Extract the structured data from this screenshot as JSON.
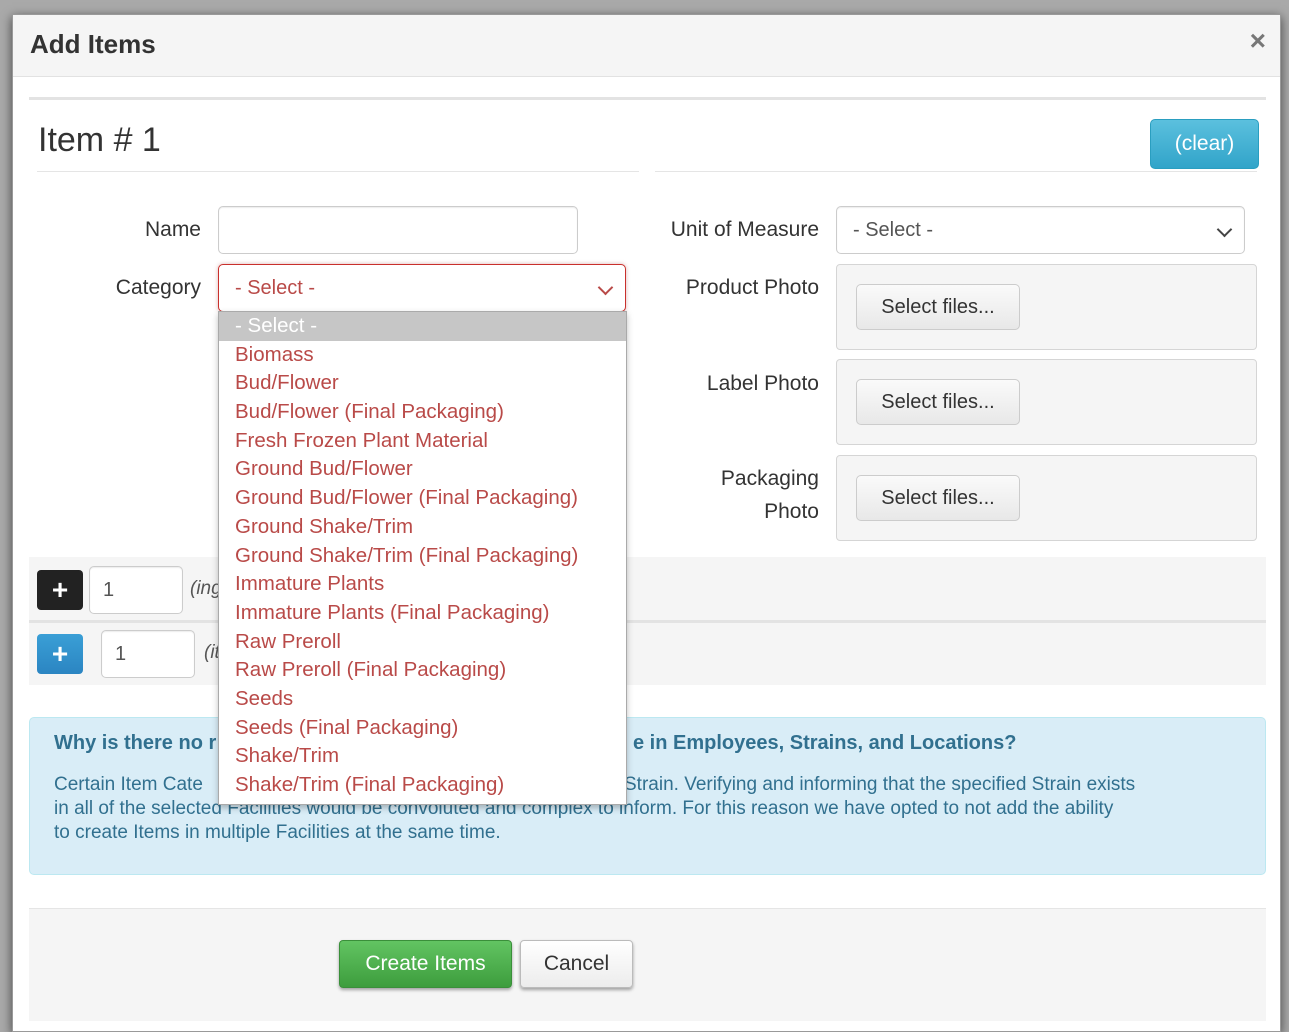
{
  "modal": {
    "title": "Add Items",
    "close_symbol": "×"
  },
  "item": {
    "heading": "Item # 1",
    "clear_label": "(clear)"
  },
  "form": {
    "name_label": "Name",
    "name_value": "",
    "category_label": "Category",
    "category_value": "- Select -",
    "unit_label": "Unit of Measure",
    "unit_value": "- Select -",
    "product_photo_label": "Product Photo",
    "label_photo_label": "Label Photo",
    "packaging_photo_label_1": "Packaging",
    "packaging_photo_label_2": "Photo",
    "select_files_label": "Select files..."
  },
  "category_options": [
    "- Select -",
    "Biomass",
    "Bud/Flower",
    "Bud/Flower (Final Packaging)",
    "Fresh Frozen Plant Material",
    "Ground Bud/Flower",
    "Ground Bud/Flower (Final Packaging)",
    "Ground Shake/Trim",
    "Ground Shake/Trim (Final Packaging)",
    "Immature Plants",
    "Immature Plants (Final Packaging)",
    "Raw Preroll",
    "Raw Preroll (Final Packaging)",
    "Seeds",
    "Seeds (Final Packaging)",
    "Shake/Trim",
    "Shake/Trim (Final Packaging)"
  ],
  "add_rows": {
    "ingredient_count": "1",
    "ingredient_hint": "(ing",
    "item_count": "1",
    "item_hint": "(it",
    "plus_symbol": "+"
  },
  "info": {
    "title_start": "Why is there no r",
    "title_end": "e in Employees, Strains, and Locations?",
    "line1_start": "Certain Item Cate",
    "line1_end": "Strain. Verifying and informing that the specified Strain exists",
    "line2": "in all of the selected Facilities would be convoluted and complex to inform. For this reason we have opted to not add the ability",
    "line3": "to create Items in multiple Facilities at the same time."
  },
  "footer": {
    "create_label": "Create Items",
    "cancel_label": "Cancel"
  },
  "colors": {
    "info_bg": "#d9edf7",
    "info_text": "#31708f",
    "error_red": "#b94a48",
    "create_green": "#5cb85c",
    "clear_blue": "#5bc0de"
  }
}
